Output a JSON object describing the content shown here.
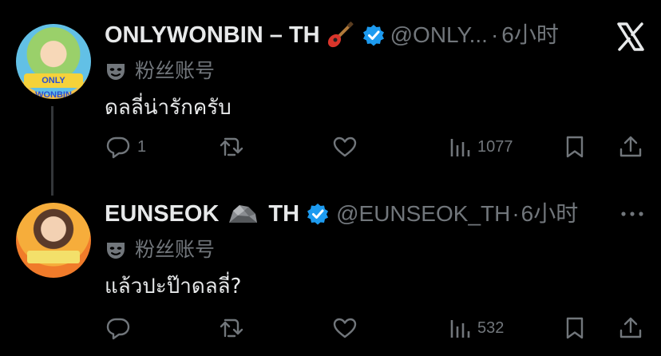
{
  "posts": [
    {
      "avatar_label": "ONLY WONBIN",
      "display_name": "ONLYWONBIN – TH",
      "name_emoji_icon": "guitar-icon",
      "verified_icon": "verified-badge-icon",
      "handle": "@ONLY...",
      "separator": "·",
      "time": "6小时",
      "account_label": "粉丝账号",
      "account_label_icon": "mask-icon",
      "text": "ดลลี่น่ารักครับ",
      "reply_count": "1",
      "retweet_count": "",
      "like_count": "",
      "views_count": "1077",
      "header_right_icon": "x-logo-icon"
    },
    {
      "avatar_label": "",
      "display_name_part1": "EUNSEOK",
      "display_name_part2": "TH",
      "name_emoji_icon": "rock-icon",
      "verified_icon": "verified-badge-icon",
      "handle": "@EUNSEOK_TH",
      "separator": "·",
      "time": "6小时",
      "account_label": "粉丝账号",
      "account_label_icon": "mask-icon",
      "text": "แล้วปะป๊าดลลี่?",
      "reply_count": "",
      "retweet_count": "",
      "like_count": "",
      "views_count": "532",
      "header_right_icon": "more-dots-icon"
    }
  ],
  "colors": {
    "background": "#000000",
    "primary_text": "#e7e9ea",
    "secondary_text": "#71767b",
    "verified_blue": "#1d9bf0",
    "thread_line": "#333639"
  }
}
